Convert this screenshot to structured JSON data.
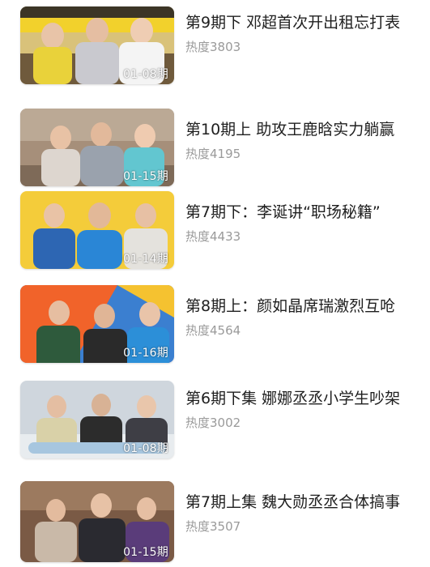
{
  "list": {
    "items": [
      {
        "title": "第9期下 邓超首次开出租忘打表",
        "heat": "热度3803",
        "date": "01-08期"
      },
      {
        "title": "第10期上 助攻王鹿晗实力躺赢",
        "heat": "热度4195",
        "date": "01-15期"
      },
      {
        "title": "第7期下：李诞讲“职场秘籍”",
        "heat": "热度4433",
        "date": "01-14期"
      },
      {
        "title": "第8期上：颜如晶席瑞激烈互呛",
        "heat": "热度4564",
        "date": "01-16期"
      },
      {
        "title": "第6期下集 娜娜丞丞小学生吵架",
        "heat": "热度3002",
        "date": "01-08期"
      },
      {
        "title": "第7期上集 魏大勋丞丞合体搞事",
        "heat": "热度3507",
        "date": "01-15期"
      }
    ]
  }
}
